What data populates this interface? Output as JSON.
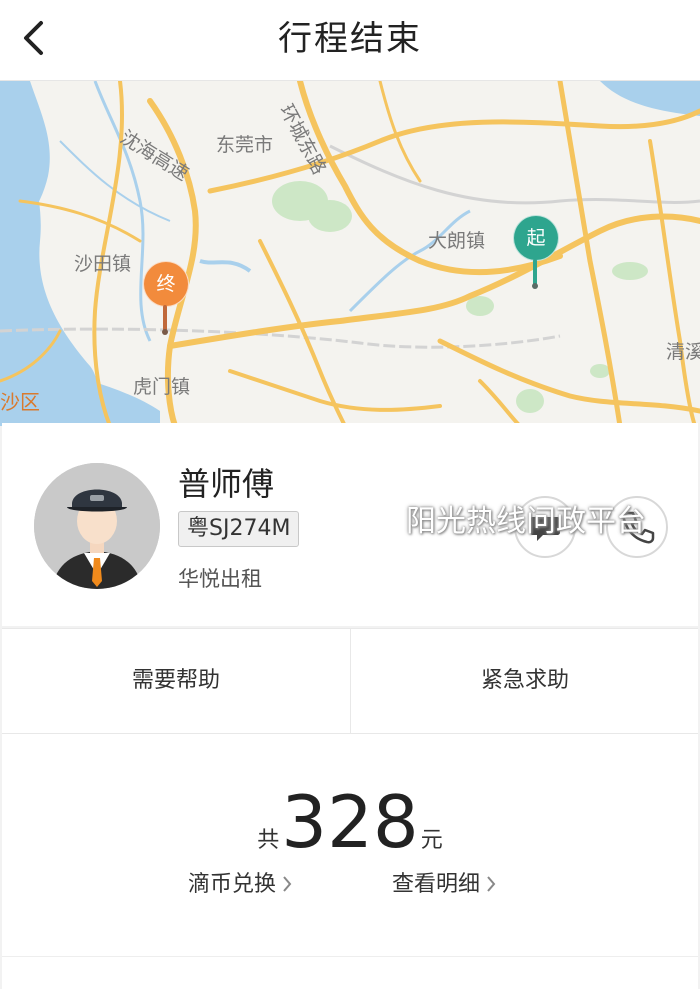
{
  "header": {
    "title": "行程结束"
  },
  "map": {
    "labels": {
      "dongguan": "东莞市",
      "yanhai": "沈海高速",
      "huancheng": "环城东路",
      "dalang": "大朗镇",
      "shatian": "沙田镇",
      "humen": "虎门镇",
      "qingxi": "清溪",
      "shaqu": "沙区"
    },
    "start_pin": "起",
    "end_pin": "终",
    "colors": {
      "start": "#2ea58e",
      "end": "#f28b3c",
      "road": "#f5c45e",
      "water": "#a9d0ec",
      "green": "#cde7c6"
    }
  },
  "driver": {
    "name": "普师傅",
    "plate": "粤SJ274M",
    "company": "华悦出租"
  },
  "watermark": "阳光热线问政平台",
  "help": {
    "need_help": "需要帮助",
    "emergency": "紧急求助"
  },
  "fare": {
    "prefix": "共",
    "amount": "328",
    "suffix": "元",
    "coin_exchange": "滴币兑换",
    "view_details": "查看明细"
  }
}
